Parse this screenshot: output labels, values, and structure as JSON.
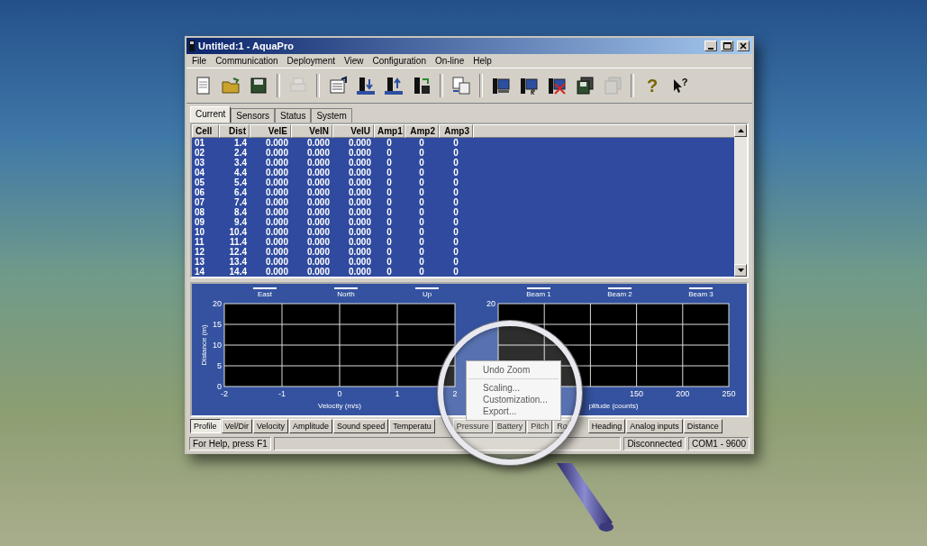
{
  "window": {
    "title": "Untitled:1 - AquaPro"
  },
  "menu": [
    "File",
    "Communication",
    "Deployment",
    "View",
    "Configuration",
    "On-line",
    "Help"
  ],
  "toolbar": [
    {
      "disabled": false
    },
    {
      "disabled": false
    },
    {
      "disabled": false
    },
    {
      "disabled": true
    },
    {
      "disabled": false
    },
    {
      "disabled": false
    },
    {
      "disabled": false
    },
    {
      "disabled": false
    },
    {
      "disabled": false
    },
    {
      "disabled": false
    },
    {
      "disabled": false
    },
    {
      "disabled": false
    },
    {
      "disabled": false
    },
    {
      "disabled": true
    },
    {
      "disabled": false,
      "glyph": "?"
    },
    {
      "disabled": false,
      "glyph": "?"
    }
  ],
  "top_tabs": [
    {
      "label": "Current",
      "selected": true
    },
    {
      "label": "Sensors",
      "selected": false
    },
    {
      "label": "Status",
      "selected": false
    },
    {
      "label": "System",
      "selected": false
    }
  ],
  "table": {
    "columns": [
      "Cell",
      "Dist",
      "VelE",
      "VelN",
      "VelU",
      "Amp1",
      "Amp2",
      "Amp3"
    ],
    "rows": [
      [
        "01",
        "1.4",
        "0.000",
        "0.000",
        "0.000",
        "0",
        "0",
        "0"
      ],
      [
        "02",
        "2.4",
        "0.000",
        "0.000",
        "0.000",
        "0",
        "0",
        "0"
      ],
      [
        "03",
        "3.4",
        "0.000",
        "0.000",
        "0.000",
        "0",
        "0",
        "0"
      ],
      [
        "04",
        "4.4",
        "0.000",
        "0.000",
        "0.000",
        "0",
        "0",
        "0"
      ],
      [
        "05",
        "5.4",
        "0.000",
        "0.000",
        "0.000",
        "0",
        "0",
        "0"
      ],
      [
        "06",
        "6.4",
        "0.000",
        "0.000",
        "0.000",
        "0",
        "0",
        "0"
      ],
      [
        "07",
        "7.4",
        "0.000",
        "0.000",
        "0.000",
        "0",
        "0",
        "0"
      ],
      [
        "08",
        "8.4",
        "0.000",
        "0.000",
        "0.000",
        "0",
        "0",
        "0"
      ],
      [
        "09",
        "9.4",
        "0.000",
        "0.000",
        "0.000",
        "0",
        "0",
        "0"
      ],
      [
        "10",
        "10.4",
        "0.000",
        "0.000",
        "0.000",
        "0",
        "0",
        "0"
      ],
      [
        "11",
        "11.4",
        "0.000",
        "0.000",
        "0.000",
        "0",
        "0",
        "0"
      ],
      [
        "12",
        "12.4",
        "0.000",
        "0.000",
        "0.000",
        "0",
        "0",
        "0"
      ],
      [
        "13",
        "13.4",
        "0.000",
        "0.000",
        "0.000",
        "0",
        "0",
        "0"
      ],
      [
        "14",
        "14.4",
        "0.000",
        "0.000",
        "0.000",
        "0",
        "0",
        "0"
      ]
    ]
  },
  "charts": [
    {
      "legend": [
        "East",
        "North",
        "Up"
      ],
      "x_tick_labels": [
        "-2",
        "-1",
        "0",
        "1",
        "2"
      ],
      "y_tick_labels": [
        "20",
        "15",
        "10",
        "5",
        "0"
      ],
      "xlabel": "Velocity (m/s)",
      "ylabel": "Distance (m)"
    },
    {
      "legend": [
        "Beam 1",
        "Beam 2",
        "Beam 3"
      ],
      "x_tick_labels": [
        "150",
        "200",
        "250"
      ],
      "y_tick_labels": [
        "20"
      ],
      "xlabel": "plitude (counts)"
    }
  ],
  "context_menu": {
    "items": [
      "Undo Zoom",
      "Scaling...",
      "Customization...",
      "Export..."
    ]
  },
  "bottom_tabs": [
    {
      "label": "Profile",
      "selected": true
    },
    {
      "label": "Vel/Dir",
      "selected": false
    },
    {
      "label": "Velocity",
      "selected": false
    },
    {
      "label": "Amplitude",
      "selected": false
    },
    {
      "label": "Sound speed",
      "selected": false
    },
    {
      "label": "Temperatu",
      "selected": false
    },
    {
      "label": "Pressure",
      "selected": false
    },
    {
      "label": "Battery",
      "selected": false
    },
    {
      "label": "Pitch",
      "selected": false
    },
    {
      "label": "Ro",
      "selected": false
    },
    {
      "label": "Heading",
      "selected": false
    },
    {
      "label": "Analog inputs",
      "selected": false
    },
    {
      "label": "Distance",
      "selected": false
    }
  ],
  "status_bar": {
    "help": "For Help, press F1",
    "connection": "Disconnected",
    "port": "COM1 - 9600"
  }
}
